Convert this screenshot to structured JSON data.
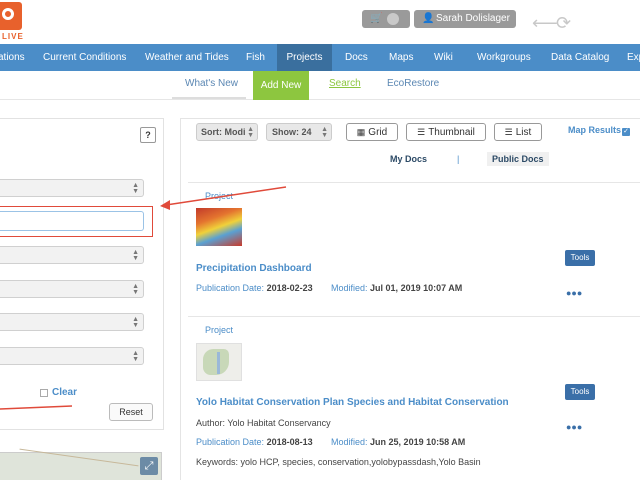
{
  "header": {
    "logo_text": "LIVE",
    "user_name": "Sarah Dolislager",
    "icons": {
      "cart": "cart-icon",
      "user": "user-icon",
      "back": "back-arrow-icon",
      "refresh": "refresh-icon"
    }
  },
  "nav": {
    "items": [
      {
        "label": "ations"
      },
      {
        "label": "Current Conditions"
      },
      {
        "label": "Weather and Tides"
      },
      {
        "label": "Fish"
      },
      {
        "label": "Projects",
        "active": true
      },
      {
        "label": "Docs"
      },
      {
        "label": "Maps"
      },
      {
        "label": "Wiki"
      },
      {
        "label": "Workgroups"
      },
      {
        "label": "Data Catalog"
      },
      {
        "label": "Exp"
      }
    ]
  },
  "subnav": {
    "items": [
      {
        "label": "What's New"
      },
      {
        "label": "Add New"
      },
      {
        "label": "Search",
        "active": true
      },
      {
        "label": "EcoRestore"
      }
    ]
  },
  "left_panel": {
    "help_label": "?",
    "clear_label": "Clear",
    "reset_label": "Reset"
  },
  "toolbar": {
    "sort_label": "Sort: Modi",
    "show_label": "Show: 24",
    "grid_label": "Grid",
    "thumbnail_label": "Thumbnail",
    "list_label": "List",
    "map_results_label": "Map Results",
    "my_docs_label": "My Docs",
    "separator": "|",
    "public_docs_label": "Public Docs"
  },
  "results": [
    {
      "type": "Project",
      "title": "Precipitation Dashboard",
      "pub_label": "Publication Date:",
      "pub_date": "2018-02-23",
      "mod_label": "Modified:",
      "mod_date": "Jul 01, 2019 10:07 AM",
      "tools_label": "Tools"
    },
    {
      "type": "Project",
      "title": "Yolo Habitat Conservation Plan Species and Habitat Conservation",
      "author": "Author: Yolo Habitat Conservancy",
      "pub_label": "Publication Date:",
      "pub_date": "2018-08-13",
      "mod_label": "Modified:",
      "mod_date": "Jun 25, 2019 10:58 AM",
      "keywords": "Keywords: yolo HCP, species, conservation,yolobypassdash,Yolo Basin",
      "tools_label": "Tools"
    }
  ],
  "colors": {
    "nav_bg": "#4b8dc8",
    "nav_active": "#3a6f9e",
    "add_new": "#8dc63f",
    "annotation_red": "#e04a3a"
  }
}
